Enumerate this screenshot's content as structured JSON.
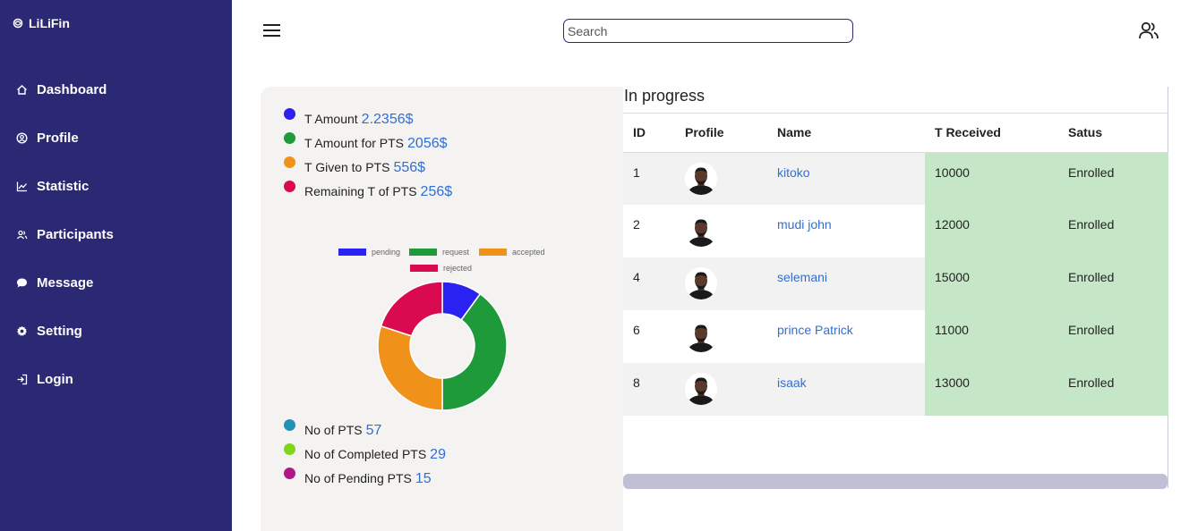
{
  "sidebar": {
    "brand": "LiLiFin",
    "items": [
      {
        "label": "Dashboard",
        "icon": "home-icon"
      },
      {
        "label": "Profile",
        "icon": "user-circle-icon"
      },
      {
        "label": "Statistic",
        "icon": "chart-line-icon"
      },
      {
        "label": "Participants",
        "icon": "users-icon"
      },
      {
        "label": "Message",
        "icon": "chat-bubble-icon"
      },
      {
        "label": "Setting",
        "icon": "gear-icon"
      },
      {
        "label": "Login",
        "icon": "login-icon"
      }
    ]
  },
  "header": {
    "search_placeholder": "Search"
  },
  "stats_top": [
    {
      "label": "T Amount",
      "value": "2.2356$",
      "color": "#2a22f0"
    },
    {
      "label": "T Amount for PTS",
      "value": "2056$",
      "color": "#1e9a3a"
    },
    {
      "label": "T Given to PTS",
      "value": "556$",
      "color": "#f0921a"
    },
    {
      "label": "Remaining T of PTS",
      "value": "256$",
      "color": "#d90a50"
    }
  ],
  "chart_data": {
    "type": "pie",
    "categories": [
      "pending",
      "request",
      "accepted",
      "rejected"
    ],
    "values": [
      10,
      40,
      30,
      20
    ],
    "colors": [
      "#2a22f0",
      "#1e9a3a",
      "#f0921a",
      "#d90a50"
    ],
    "legend": "top"
  },
  "stats_bottom": [
    {
      "label": "No of PTS",
      "value": "57",
      "color": "#2191b8"
    },
    {
      "label": "No of Completed PTS",
      "value": "29",
      "color": "#80d41a"
    },
    {
      "label": "No of Pending PTS",
      "value": "15",
      "color": "#b0178a"
    }
  ],
  "table": {
    "title": "In progress",
    "columns": [
      "ID",
      "Profile",
      "Name",
      "T Received",
      "Satus"
    ],
    "rows": [
      {
        "id": "1",
        "name": "kitoko",
        "received": "10000",
        "status": "Enrolled"
      },
      {
        "id": "2",
        "name": "mudi john",
        "received": "12000",
        "status": "Enrolled"
      },
      {
        "id": "4",
        "name": "selemani",
        "received": "15000",
        "status": "Enrolled"
      },
      {
        "id": "6",
        "name": "prince Patrick",
        "received": "11000",
        "status": "Enrolled"
      },
      {
        "id": "8",
        "name": "isaak",
        "received": "13000",
        "status": "Enrolled"
      }
    ]
  }
}
